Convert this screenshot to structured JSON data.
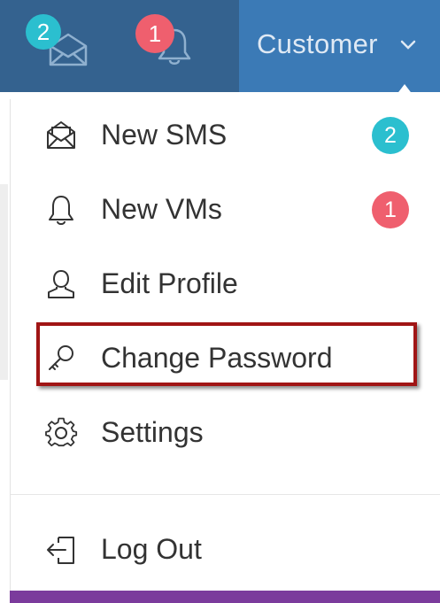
{
  "topbar": {
    "messages_badge": "2",
    "notifications_badge": "1",
    "user_name": "Customer"
  },
  "menu": {
    "items": [
      {
        "label": "New SMS",
        "icon": "envelope-open-icon",
        "badge": "2",
        "badge_color": "#2bbfcf"
      },
      {
        "label": "New VMs",
        "icon": "bell-icon",
        "badge": "1",
        "badge_color": "#ef5f6e"
      },
      {
        "label": "Edit Profile",
        "icon": "user-icon"
      },
      {
        "label": "Change Password",
        "icon": "key-icon"
      },
      {
        "label": "Settings",
        "icon": "gear-icon"
      },
      {
        "label": "Log Out",
        "icon": "logout-icon"
      }
    ]
  },
  "colors": {
    "topbar": "#34628f",
    "user_tab": "#3b7ab6",
    "highlight_border": "#a01515",
    "footer_bar": "#7b3b9c"
  }
}
